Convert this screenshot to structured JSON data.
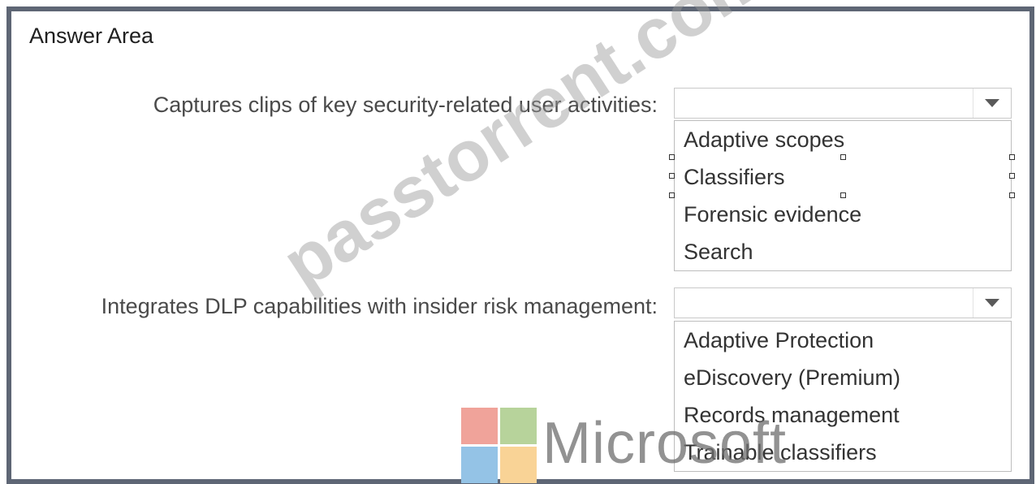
{
  "answer_area": {
    "title": "Answer Area"
  },
  "questions": [
    {
      "label": "Captures clips of key security-related user activities:",
      "selected": "",
      "options": [
        "Adaptive scopes",
        "Classifiers",
        "Forensic evidence",
        "Search"
      ]
    },
    {
      "label": "Integrates DLP capabilities with insider risk management:",
      "selected": "",
      "options": [
        "Adaptive Protection",
        "eDiscovery (Premium)",
        "Records management",
        "Trainable classifiers"
      ]
    }
  ],
  "watermark": {
    "site": "passtorrent.com",
    "brand": "Microsoft"
  },
  "colors": {
    "frame": "#5e6675",
    "logo_red": "#f0a39a",
    "logo_green": "#b7d39b",
    "logo_blue": "#94c3e6",
    "logo_yellow": "#f9d396"
  },
  "icons": {
    "dropdown": "caret-down-icon"
  }
}
